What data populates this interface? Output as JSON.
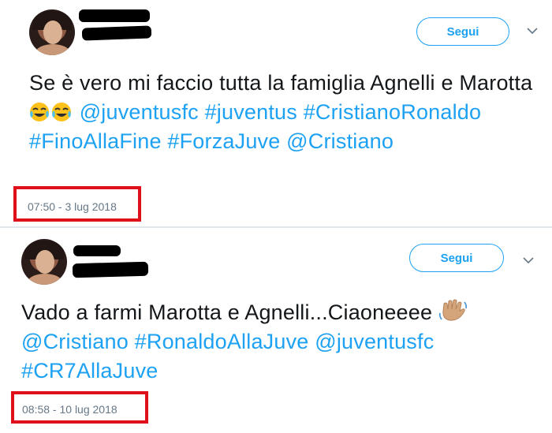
{
  "tweets": [
    {
      "follow_label": "Segui",
      "text_prefix": "Se è vero mi faccio tutta la famiglia Agnelli e Marotta",
      "emojis": [
        "crying-laughing-emoji",
        "crying-laughing-emoji"
      ],
      "links": [
        "@juventusfc",
        "#juventus",
        "#CristianoRonaldo",
        "#FinoAllaFine",
        "#ForzaJuve",
        "@Cristiano"
      ],
      "timestamp": "07:50 - 3 lug 2018"
    },
    {
      "follow_label": "Segui",
      "text_prefix": "Vado a farmi Marotta e Agnelli...Ciaoneeee",
      "emojis": [
        "waving-hand-emoji"
      ],
      "links": [
        "@Cristiano",
        "#RonaldoAllaJuve",
        "@juventusfc",
        "#CR7AllaJuve"
      ],
      "timestamp": "08:58 - 10 lug 2018"
    }
  ],
  "colors": {
    "link": "#1da1f2",
    "highlight_box": "#e0101a",
    "timestamp": "#657786"
  }
}
